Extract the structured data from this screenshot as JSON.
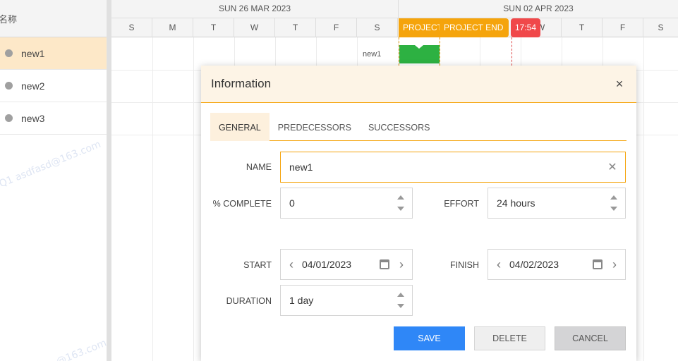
{
  "tree": {
    "header": "名称",
    "rows": [
      {
        "label": "new1",
        "selected": true
      },
      {
        "label": "new2",
        "selected": false
      },
      {
        "label": "new3",
        "selected": false
      }
    ]
  },
  "timeline": {
    "weeks": [
      "SUN 26 MAR 2023",
      "SUN 02 APR 2023"
    ],
    "days": [
      "S",
      "M",
      "T",
      "W",
      "T",
      "F",
      "S",
      "",
      "",
      "",
      "W",
      "T",
      "F",
      "S"
    ],
    "tags": {
      "project": "PROJECT",
      "project_end": "PROJECT END",
      "time": "17:54"
    },
    "task_label": "new1"
  },
  "watermark": "Q1 asdfasd@163.com",
  "watermark2": "@163.com",
  "dialog": {
    "title": "Information",
    "close": "×",
    "tabs": [
      "GENERAL",
      "PREDECESSORS",
      "SUCCESSORS"
    ],
    "fields": {
      "name_label": "NAME",
      "name_value": "new1",
      "complete_label": "% COMPLETE",
      "complete_value": "0",
      "effort_label": "EFFORT",
      "effort_value": "24 hours",
      "start_label": "START",
      "start_value": "04/01/2023",
      "finish_label": "FINISH",
      "finish_value": "04/02/2023",
      "duration_label": "DURATION",
      "duration_value": "1 day"
    },
    "buttons": {
      "save": "SAVE",
      "delete": "DELETE",
      "cancel": "CANCEL"
    }
  },
  "colors": {
    "accent": "#f5a40c",
    "primary": "#2f87f7",
    "task": "#2db142",
    "now": "#f0484a"
  }
}
